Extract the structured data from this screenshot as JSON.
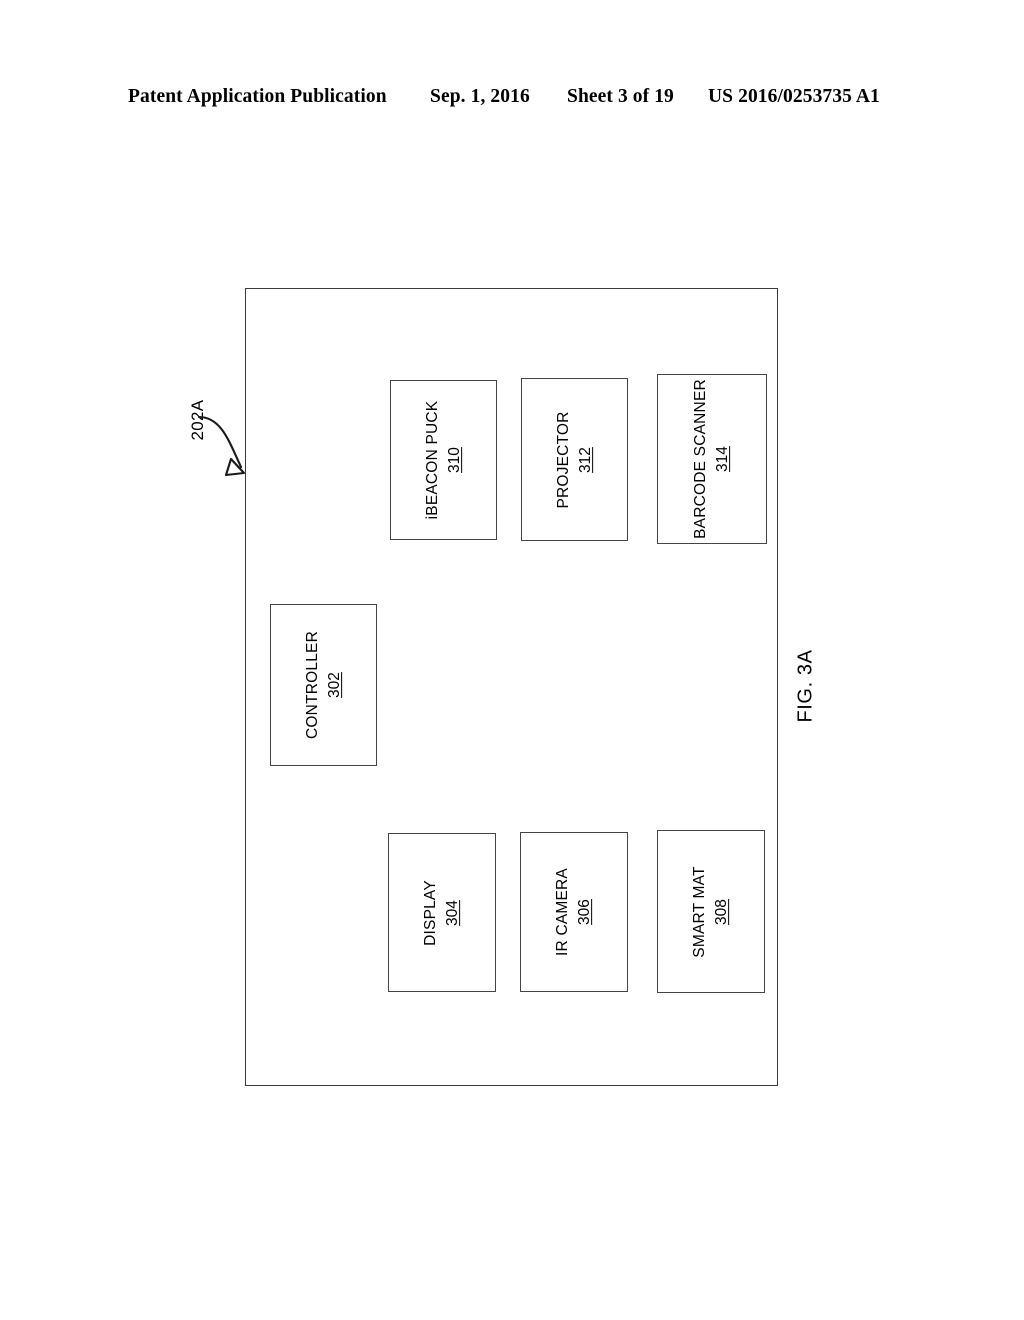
{
  "header": {
    "publication": "Patent Application Publication",
    "date": "Sep. 1, 2016",
    "sheet": "Sheet 3 of 19",
    "document_number": "US 2016/0253735 A1"
  },
  "figure": {
    "caption": "FIG. 3A",
    "enclosure_ref": "202A",
    "components": [
      {
        "title": "iBEACON PUCK",
        "ref": "310"
      },
      {
        "title": "PROJECTOR",
        "ref": "312"
      },
      {
        "title": "BARCODE SCANNER",
        "ref": "314"
      },
      {
        "title": "CONTROLLER",
        "ref": "302"
      },
      {
        "title": "DISPLAY",
        "ref": "304"
      },
      {
        "title": "IR CAMERA",
        "ref": "306"
      },
      {
        "title": "SMART MAT",
        "ref": "308"
      }
    ]
  },
  "colors": {
    "ink": "#000000",
    "line": "#3b3b3b",
    "paper": "#ffffff"
  }
}
